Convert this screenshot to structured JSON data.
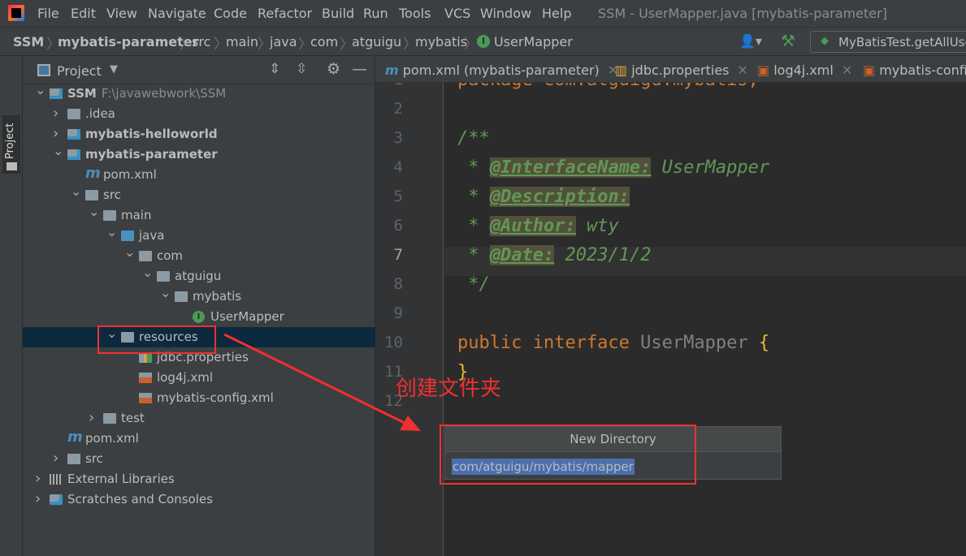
{
  "menu": [
    "File",
    "Edit",
    "View",
    "Navigate",
    "Code",
    "Refactor",
    "Build",
    "Run",
    "Tools",
    "VCS",
    "Window",
    "Help"
  ],
  "window_title": "SSM - UserMapper.java [mybatis-parameter]",
  "breadcrumb": [
    "SSM",
    "mybatis-parameter",
    "src",
    "main",
    "java",
    "com",
    "atguigu",
    "mybatis",
    "UserMapper"
  ],
  "run_config": "MyBatisTest.getAllUser",
  "tool_window_tab": "Project",
  "panel": {
    "title": "Project"
  },
  "tree": [
    {
      "label": "SSM",
      "path": "F:\\javawebwork\\SSM"
    },
    {
      "label": ".idea"
    },
    {
      "label": "mybatis-helloworld"
    },
    {
      "label": "mybatis-parameter"
    },
    {
      "label": "pom.xml"
    },
    {
      "label": "src"
    },
    {
      "label": "main"
    },
    {
      "label": "java"
    },
    {
      "label": "com"
    },
    {
      "label": "atguigu"
    },
    {
      "label": "mybatis"
    },
    {
      "label": "UserMapper"
    },
    {
      "label": "resources"
    },
    {
      "label": "jdbc.properties"
    },
    {
      "label": "log4j.xml"
    },
    {
      "label": "mybatis-config.xml"
    },
    {
      "label": "test"
    },
    {
      "label": "pom.xml"
    },
    {
      "label": "src"
    },
    {
      "label": "External Libraries"
    },
    {
      "label": "Scratches and Consoles"
    }
  ],
  "tabs": [
    "pom.xml (mybatis-parameter)",
    "jdbc.properties",
    "log4j.xml",
    "mybatis-config.xml"
  ],
  "code": {
    "line_numbers": [
      "1",
      "2",
      "3",
      "4",
      "5",
      "6",
      "7",
      "8",
      "9",
      "10",
      "11",
      "12"
    ],
    "l1": "package com.atguigu.mybatis;",
    "l3": "/**",
    "star": " * ",
    "tag_interface": "@InterfaceName:",
    "val_interface": " UserMapper",
    "tag_desc": "@Description:",
    "tag_author": "@Author:",
    "val_author": " wty",
    "tag_date": "@Date:",
    "val_date": " 2023/1/2",
    "l8": " */",
    "l10_kw": "public interface ",
    "l10_name": "UserMapper ",
    "l10_brace": "{",
    "l11": "}"
  },
  "annotation": "创建文件夹",
  "popup": {
    "title": "New Directory",
    "value": "com/atguigu/mybatis/mapper"
  },
  "colors": {
    "annotation": "#f03030",
    "selection": "#4b6eaf",
    "keyword": "#cc7832",
    "doc": "#629755"
  }
}
